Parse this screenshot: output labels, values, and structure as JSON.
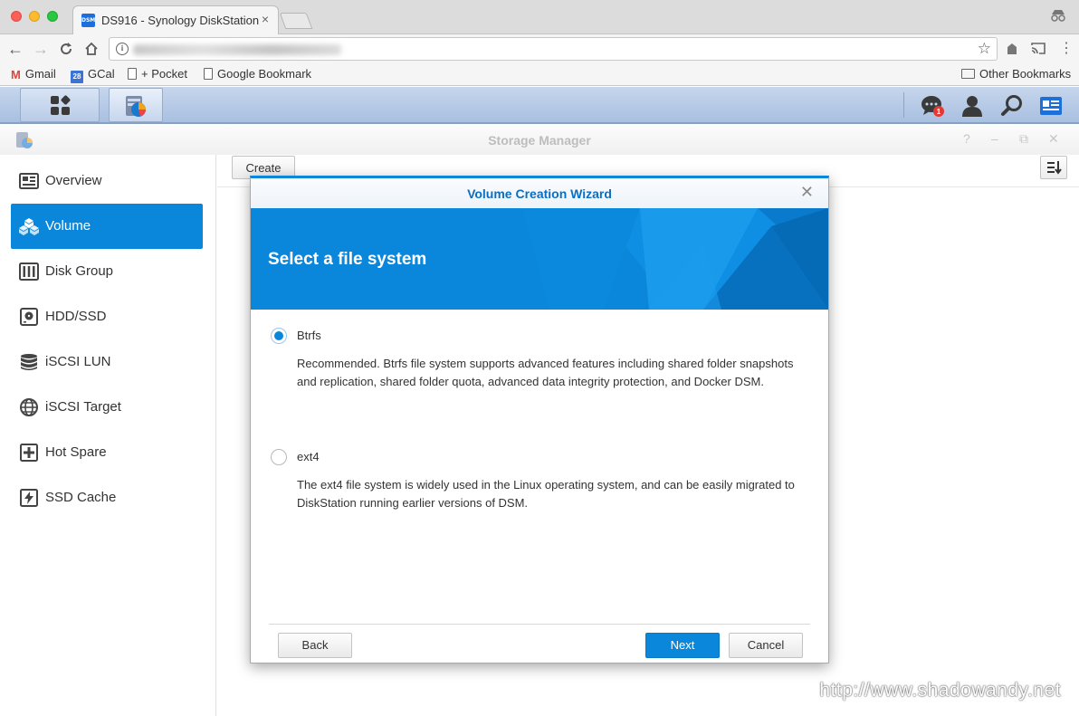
{
  "browser": {
    "tab_title": "DS916 - Synology DiskStation",
    "tab_favicon_text": "DSM",
    "tab_close": "×",
    "bookmarks": [
      {
        "label": "Gmail"
      },
      {
        "label": "GCal",
        "icon_text": "28"
      },
      {
        "label": "+ Pocket"
      },
      {
        "label": "Google Bookmark"
      }
    ],
    "other_bookmarks": "Other Bookmarks"
  },
  "window": {
    "title": "Storage Manager",
    "controls": [
      "?",
      "–",
      "⧉",
      "✕"
    ]
  },
  "taskbar": {
    "notification_count": "1"
  },
  "sidebar": {
    "items": [
      {
        "label": "Overview",
        "icon": "overview-icon"
      },
      {
        "label": "Volume",
        "icon": "volume-icon",
        "active": true
      },
      {
        "label": "Disk Group",
        "icon": "disk-group-icon"
      },
      {
        "label": "HDD/SSD",
        "icon": "hdd-icon"
      },
      {
        "label": "iSCSI LUN",
        "icon": "iscsi-lun-icon"
      },
      {
        "label": "iSCSI Target",
        "icon": "iscsi-target-icon"
      },
      {
        "label": "Hot Spare",
        "icon": "hot-spare-icon"
      },
      {
        "label": "SSD Cache",
        "icon": "ssd-cache-icon"
      }
    ]
  },
  "content": {
    "create_label": "Create"
  },
  "wizard": {
    "title": "Volume Creation Wizard",
    "close": "✕",
    "heading": "Select a file system",
    "options": [
      {
        "label": "Btrfs",
        "selected": true,
        "description": "Recommended. Btrfs file system supports advanced features including shared folder snapshots and replication, shared folder quota, advanced data integrity protection, and Docker DSM."
      },
      {
        "label": "ext4",
        "selected": false,
        "description": "The ext4 file system is widely used in the Linux operating system, and can be easily migrated to DiskStation running earlier versions of DSM."
      }
    ],
    "back_label": "Back",
    "next_label": "Next",
    "cancel_label": "Cancel"
  },
  "watermark": "http://www.shadowandy.net",
  "colors": {
    "accent": "#0a87db",
    "taskbar": "#b8cbe7"
  }
}
